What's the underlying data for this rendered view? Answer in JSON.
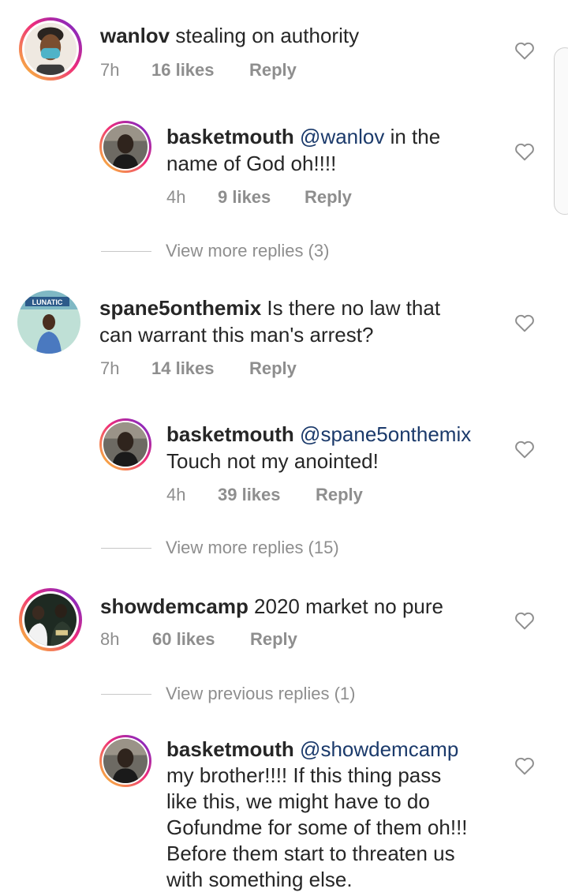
{
  "comments": [
    {
      "username": "wanlov",
      "text": " stealing on authority",
      "time": "7h",
      "likes": "16 likes",
      "reply": "Reply"
    },
    {
      "username": "basketmouth",
      "mention": "@wanlov",
      "text_line1_after": " in the",
      "text_line2": "name of God oh!!!!",
      "time": "4h",
      "likes": "9 likes",
      "reply": "Reply"
    },
    {
      "username": "spane5onthemix",
      "text_line1": " Is there no law that",
      "text_line2": "can warrant this man's arrest?",
      "avatar_badge": "LUNATIC",
      "time": "7h",
      "likes": "14 likes",
      "reply": "Reply"
    },
    {
      "username": "basketmouth",
      "mention": "@spane5onthemix",
      "text_line2": "Touch not my anointed!",
      "time": "4h",
      "likes": "39 likes",
      "reply": "Reply"
    },
    {
      "username": "showdemcamp",
      "text": " 2020 market no pure",
      "time": "8h",
      "likes": "60 likes",
      "reply": "Reply"
    },
    {
      "username": "basketmouth",
      "mention": "@showdemcamp",
      "lines": [
        "my brother!!!! If this thing pass",
        "like this, we might have to do",
        "Gofundme for some of them oh!!!",
        "Before them start to threaten us",
        "with something else."
      ]
    }
  ],
  "view_more": [
    "View more replies (3)",
    "View more replies (15)",
    "View previous replies (1)"
  ],
  "colors": {
    "text": "#262626",
    "meta": "#8e8e8e",
    "mention": "#1b3a6b"
  },
  "icons": {
    "like": "heart-outline-icon"
  }
}
